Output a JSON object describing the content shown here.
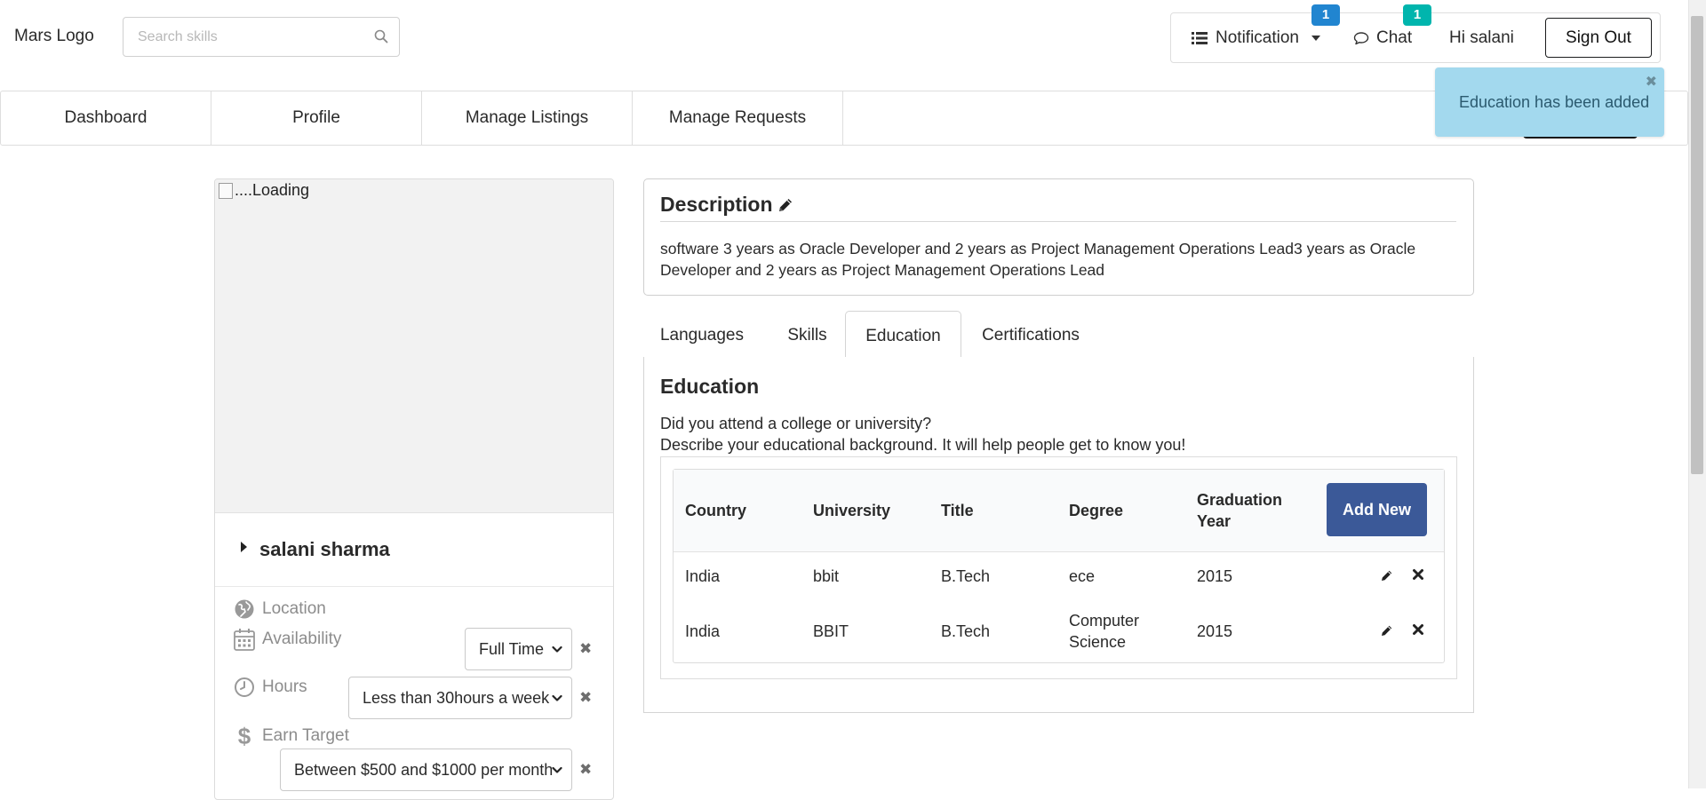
{
  "header": {
    "logo": "Mars Logo",
    "search_placeholder": "Search skills",
    "notification_label": "Notification",
    "notification_count": "1",
    "chat_label": "Chat",
    "chat_count": "1",
    "greeting": "Hi salani",
    "sign_out": "Sign Out"
  },
  "nav": {
    "items": [
      {
        "label": "Dashboard"
      },
      {
        "label": "Profile"
      },
      {
        "label": "Manage Listings"
      },
      {
        "label": "Manage Requests"
      }
    ]
  },
  "toast": {
    "message": "Education has been added"
  },
  "profile": {
    "image_alt": "....Loading",
    "name": "salani sharma",
    "location_label": "Location",
    "availability_label": "Availability",
    "availability_value": "Full Time",
    "hours_label": "Hours",
    "hours_value": "Less than 30hours a week",
    "earn_label": "Earn Target",
    "earn_value": "Between $500 and $1000 per month"
  },
  "description": {
    "title": "Description",
    "text": "software 3 years as Oracle Developer and 2 years as Project Management Operations Lead3 years as Oracle Developer and 2 years as Project Management Operations Lead"
  },
  "tabs": [
    {
      "label": "Languages",
      "active": false
    },
    {
      "label": "Skills",
      "active": false
    },
    {
      "label": "Education",
      "active": true
    },
    {
      "label": "Certifications",
      "active": false
    }
  ],
  "education": {
    "title": "Education",
    "subtitle_line1": "Did you attend a college or university?",
    "subtitle_line2": "Describe your educational background. It will help people get to know you!",
    "columns": [
      "Country",
      "University",
      "Title",
      "Degree",
      "Graduation Year"
    ],
    "add_new": "Add New",
    "rows": [
      {
        "country": "India",
        "university": "bbit",
        "title": "B.Tech",
        "degree": "ece",
        "year": "2015"
      },
      {
        "country": "India",
        "university": "BBIT",
        "title": "B.Tech",
        "degree": "Computer Science",
        "year": "2015"
      }
    ]
  },
  "colors": {
    "accent_button": "#3b5998",
    "badge_blue": "#2185d0",
    "badge_teal": "#00b5ad",
    "toast_bg": "#a3d9ee"
  }
}
